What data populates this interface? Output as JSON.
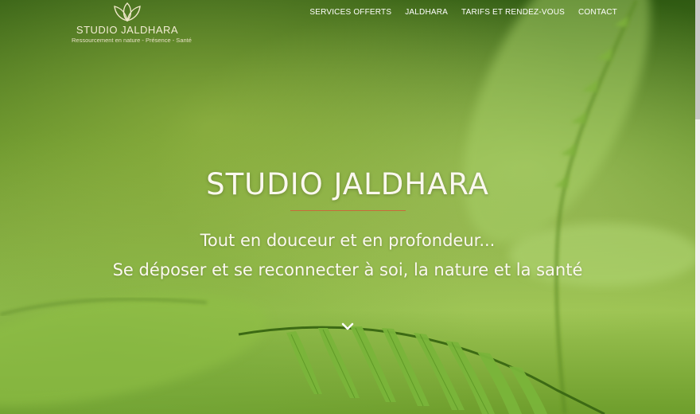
{
  "header": {
    "logo_title": "STUDIO JALDHARA",
    "logo_tagline": "Ressourcement en nature - Présence - Santé",
    "logo_icon": "lotus-icon"
  },
  "nav": {
    "items": [
      {
        "label": "SERVICES OFFERTS"
      },
      {
        "label": "JALDHARA"
      },
      {
        "label": "TARIFS ET RENDEZ-VOUS"
      },
      {
        "label": "CONTACT"
      }
    ]
  },
  "hero": {
    "title": "STUDIO JALDHARA",
    "line1": "Tout en douceur et en profondeur...",
    "line2": "Se déposer et se reconnecter à soi, la nature et la santé",
    "scroll_icon": "chevron-down-icon",
    "divider_color": "#c96a3b"
  }
}
